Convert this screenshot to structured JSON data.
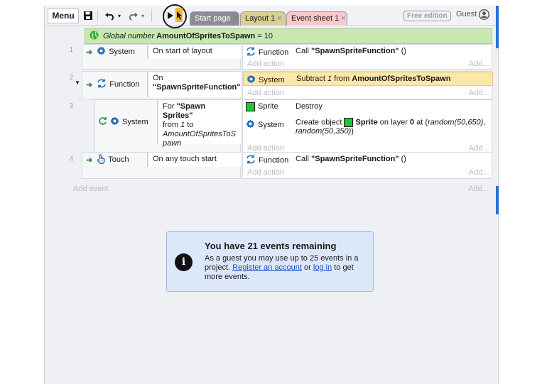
{
  "toolbar": {
    "menu_label": "Menu",
    "tabs": [
      {
        "label": "Start page",
        "close": "×"
      },
      {
        "label": "Layout 1",
        "close": "×"
      },
      {
        "label": "Event sheet 1",
        "close": "×"
      }
    ],
    "edition_badge": "Free edition",
    "user_label": "Guest"
  },
  "global_var": {
    "label": "Global number",
    "name": "AmountOfSpritesToSpawn",
    "value_text": "= 10"
  },
  "events": [
    {
      "number": "1",
      "condition": {
        "object": "System",
        "text": "On start of layout"
      },
      "actions": [
        {
          "object": "Function",
          "prefix": "Call ",
          "bold": "\"SpawnSpriteFunction\"",
          "suffix": " ()"
        }
      ],
      "add_action": "Add action",
      "add_right": "Add..."
    },
    {
      "number": "2",
      "condition": {
        "object": "Function",
        "line1": "On",
        "line2": "\"SpawnSpriteFunction\""
      },
      "actions": [
        {
          "object": "System",
          "prefix": "Subtract ",
          "ital": "1",
          "mid": " from ",
          "bold": "AmountOfSpritesToSpawn"
        }
      ],
      "add_action": "Add action",
      "add_right": "Add..."
    },
    {
      "number": "3",
      "condition": {
        "object": "System",
        "line1_prefix": "For ",
        "line1_bold": "\"Spawn Sprites\"",
        "line2_prefix": "from ",
        "line2_ital": "1",
        "line2_suffix": " to",
        "line3": "AmountOfSpritesToS",
        "line4": "pawn"
      },
      "actions": [
        {
          "object": "Sprite",
          "text": "Destroy"
        },
        {
          "object": "System",
          "prefix": "Create object ",
          "obj": "Sprite",
          "mid": " on layer ",
          "layer": "0",
          "at": " at (",
          "x": "random(50,650)",
          "comma": ",",
          "y": "random(50,350)",
          "close": ")"
        }
      ],
      "add_action": "Add action",
      "add_right": "Add..."
    },
    {
      "number": "4",
      "condition": {
        "object": "Touch",
        "text": "On any touch start"
      },
      "actions": [
        {
          "object": "Function",
          "prefix": "Call ",
          "bold": "\"SpawnSpriteFunction\"",
          "suffix": " ()"
        }
      ],
      "add_action": "Add action",
      "add_right": "Add..."
    }
  ],
  "add_event": "Add event",
  "add_event_right": "Add...",
  "notice": {
    "title": "You have 21 events remaining",
    "text1": "As a guest you may use up to 25 events in a project. ",
    "link1": "Register an account",
    "text2": " or ",
    "link2": "log in",
    "text3": " to get more events."
  },
  "colors": {
    "global_bg": "#c9e8b0",
    "highlight_bg": "#fbe8a8",
    "notice_bg": "#dce8f9",
    "sprite_green": "#22c53a",
    "tab_event_sheet": "#f6c9cc",
    "tab_layout": "#d8cf95"
  }
}
